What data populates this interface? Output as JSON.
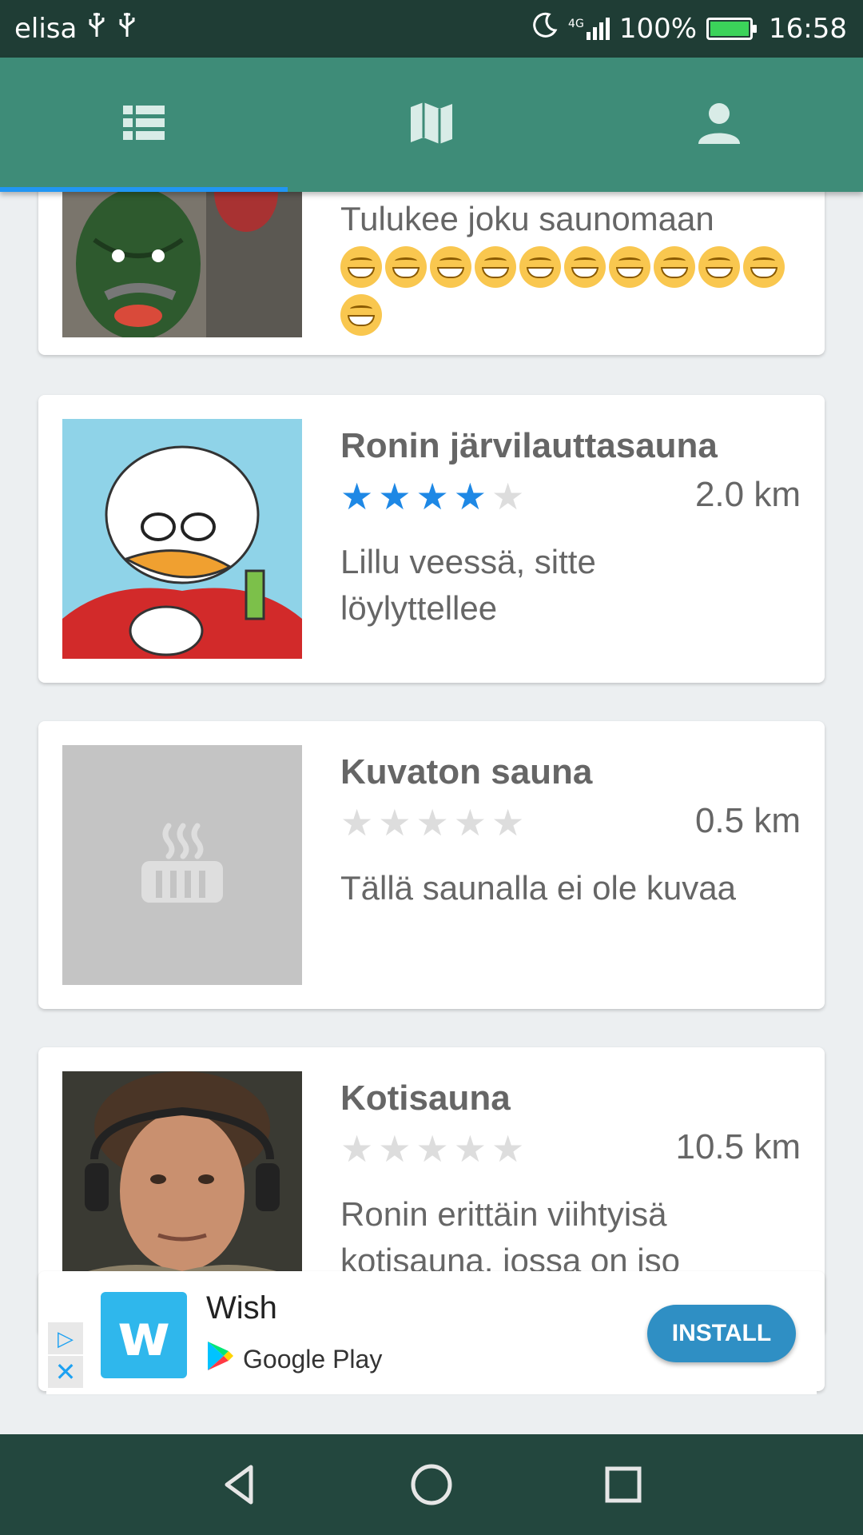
{
  "status_bar": {
    "carrier": "elisa",
    "left_icons": [
      "usb-icon",
      "usb-icon"
    ],
    "right_icons": [
      "moon-icon",
      "signal-4g-icon",
      "battery-icon"
    ],
    "network": "4G",
    "battery": "100%",
    "battery_level": 1.0,
    "time": "16:58"
  },
  "tabs": [
    {
      "icon": "list-icon",
      "selected": true
    },
    {
      "icon": "map-icon",
      "selected": false
    },
    {
      "icon": "person-icon",
      "selected": false
    }
  ],
  "colors": {
    "status_bar": "#1F3D35",
    "tab_bar": "#3E8C78",
    "tab_indicator": "#2196F3",
    "star_on": "#1E88E5",
    "star_off": "#DDDDDD",
    "nav_bar": "#23473E",
    "install_button": "#2F8FC4"
  },
  "cards": [
    {
      "title": "",
      "description": "Tulukee joku saunomaan",
      "emoji": "grinning-face-emoji",
      "emoji_count": 11
    },
    {
      "title": "Ronin järvilauttasauna",
      "rating": 4,
      "rating_max": 5,
      "distance": "2.0 km",
      "description_lines": [
        "Lillu veessä, sitte",
        "löylyttellee"
      ]
    },
    {
      "title": "Kuvaton sauna",
      "rating": 0,
      "rating_max": 5,
      "distance": "0.5 km",
      "description": "Tällä saunalla ei ole kuvaa",
      "placeholder_icon": "sauna-icon"
    },
    {
      "title": "Kotisauna",
      "rating": 0,
      "rating_max": 5,
      "distance": "10.5 km",
      "description_lines": [
        "Ronin erittäin viihtyisä",
        "kotisauna, jossa on iso"
      ]
    }
  ],
  "ad": {
    "app_name": "Wish",
    "app_logo_letter": "w",
    "store": "Google Play",
    "install_label": "INSTALL",
    "adchoices_icon": "adchoices-icon",
    "close_icon": "close-icon"
  },
  "nav_bar": {
    "buttons": [
      "back-icon",
      "home-icon",
      "recents-icon"
    ]
  }
}
